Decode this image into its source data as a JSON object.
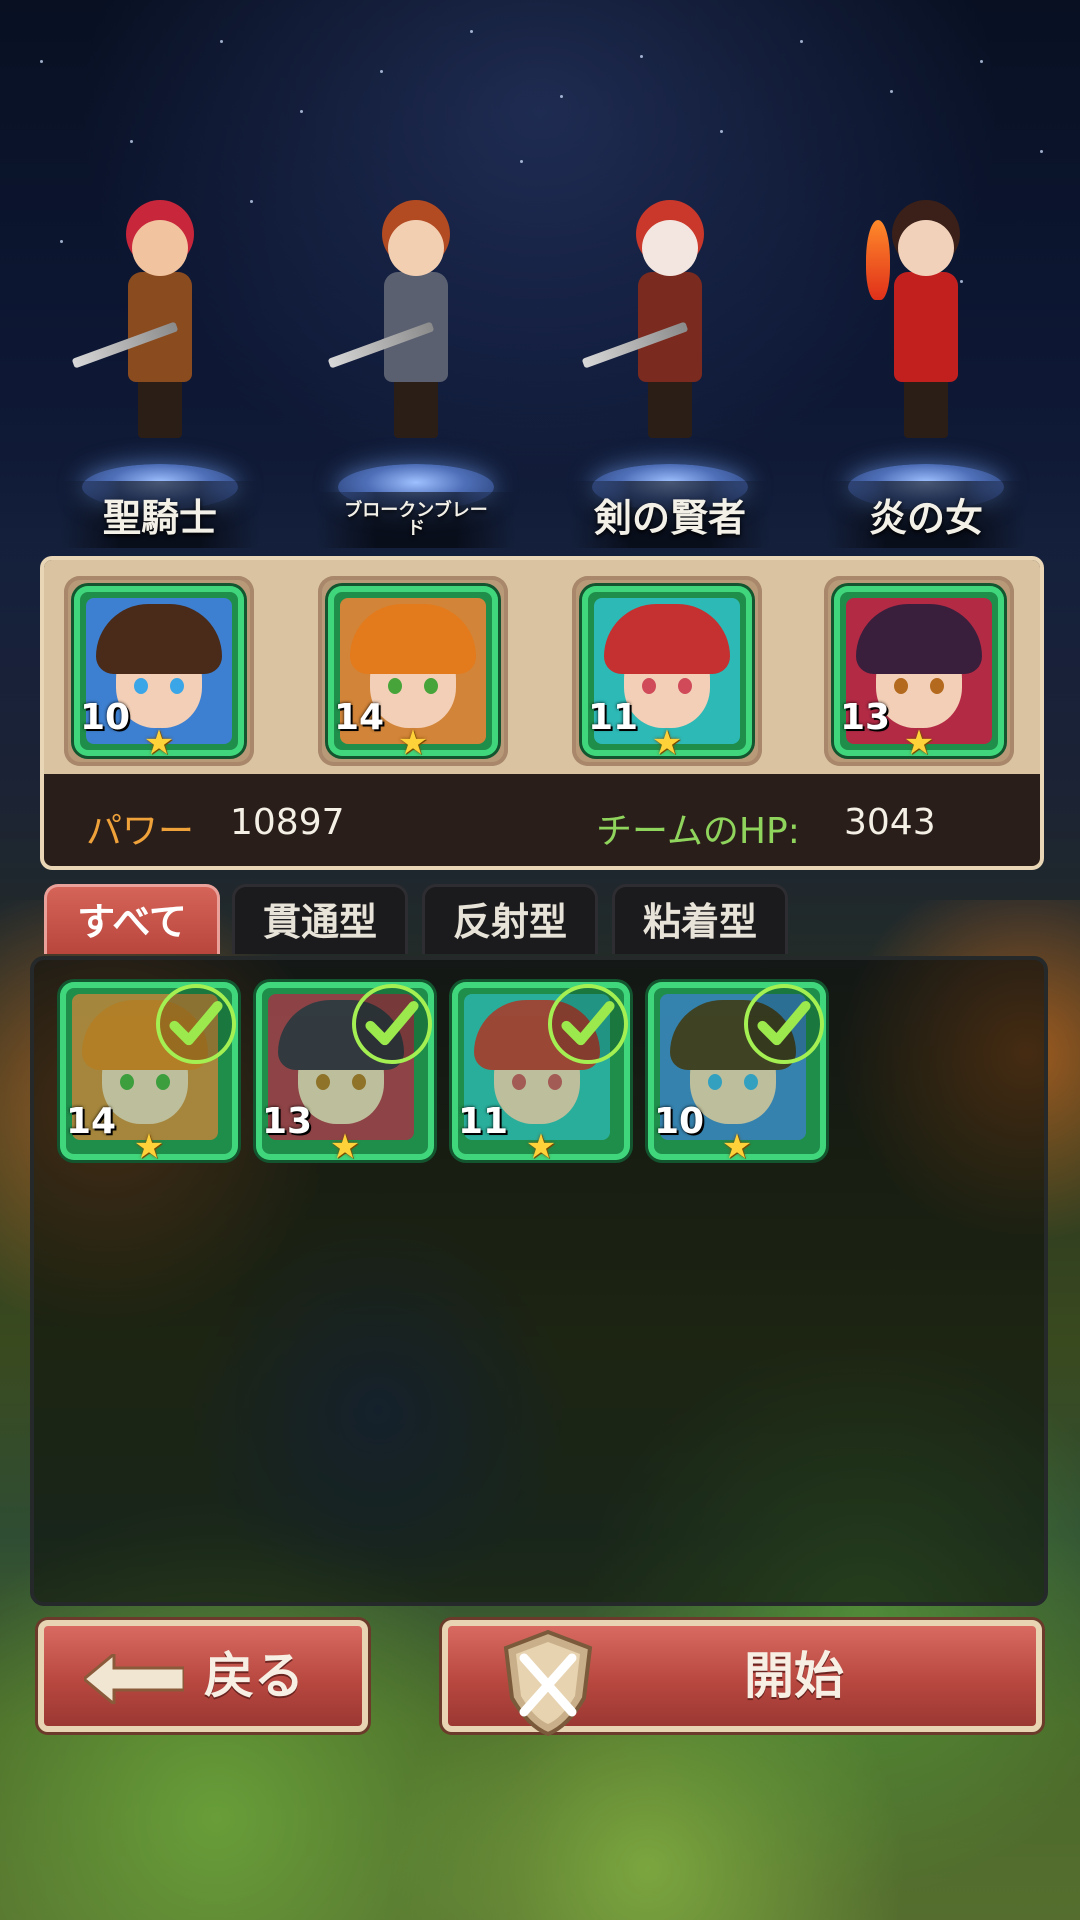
{
  "heroes": [
    {
      "name": "聖騎士",
      "hair": "#c8263a",
      "body": "#8a4b1f",
      "skin": "#f1c39f",
      "weapon": true
    },
    {
      "name": "ブロークンブレード",
      "hair": "#b24a22",
      "body": "#5a6070",
      "skin": "#f3cfb2",
      "weapon": true
    },
    {
      "name": "剣の賢者",
      "hair": "#c9382a",
      "body": "#7a2a1e",
      "skin": "#f3e6e0",
      "weapon": true
    },
    {
      "name": "炎の女",
      "hair": "#3a2018",
      "body": "#c2201e",
      "skin": "#f2d1bb",
      "weapon": false
    }
  ],
  "team": {
    "slots": [
      {
        "level": "10",
        "hair": "#4a2a18",
        "bg": "#3d7fd0",
        "eye": "#3aa6e8"
      },
      {
        "level": "14",
        "hair": "#e37a1c",
        "bg": "#d28438",
        "eye": "#47a43a"
      },
      {
        "level": "11",
        "hair": "#c53030",
        "bg": "#2db9b6",
        "eye": "#d04a5a"
      },
      {
        "level": "13",
        "hair": "#3a1f3c",
        "bg": "#b32a45",
        "eye": "#b46a1e"
      }
    ],
    "power_label": "パワー",
    "power_value": "10897",
    "hp_label": "チームのHP:",
    "hp_value": "3043",
    "star_glyph": "★"
  },
  "tabs": [
    "すべて",
    "貫通型",
    "反射型",
    "粘着型"
  ],
  "roster": [
    {
      "level": "14",
      "hair": "#e37a1c",
      "bg": "#d28438",
      "eye": "#47a43a",
      "selected": true
    },
    {
      "level": "13",
      "hair": "#3a1f3c",
      "bg": "#b32a45",
      "eye": "#b46a1e",
      "selected": true
    },
    {
      "level": "11",
      "hair": "#c53030",
      "bg": "#2db9b6",
      "eye": "#d04a5a",
      "selected": true
    },
    {
      "level": "10",
      "hair": "#4a2a18",
      "bg": "#3d7fd0",
      "eye": "#3aa6e8",
      "selected": true
    }
  ],
  "buttons": {
    "back_label": "戻る",
    "start_label": "開始"
  },
  "colors": {
    "power_label": "#f0a23a",
    "hp_label": "#8fd45c",
    "check": "#a4f053",
    "frame": "#40d67b"
  }
}
